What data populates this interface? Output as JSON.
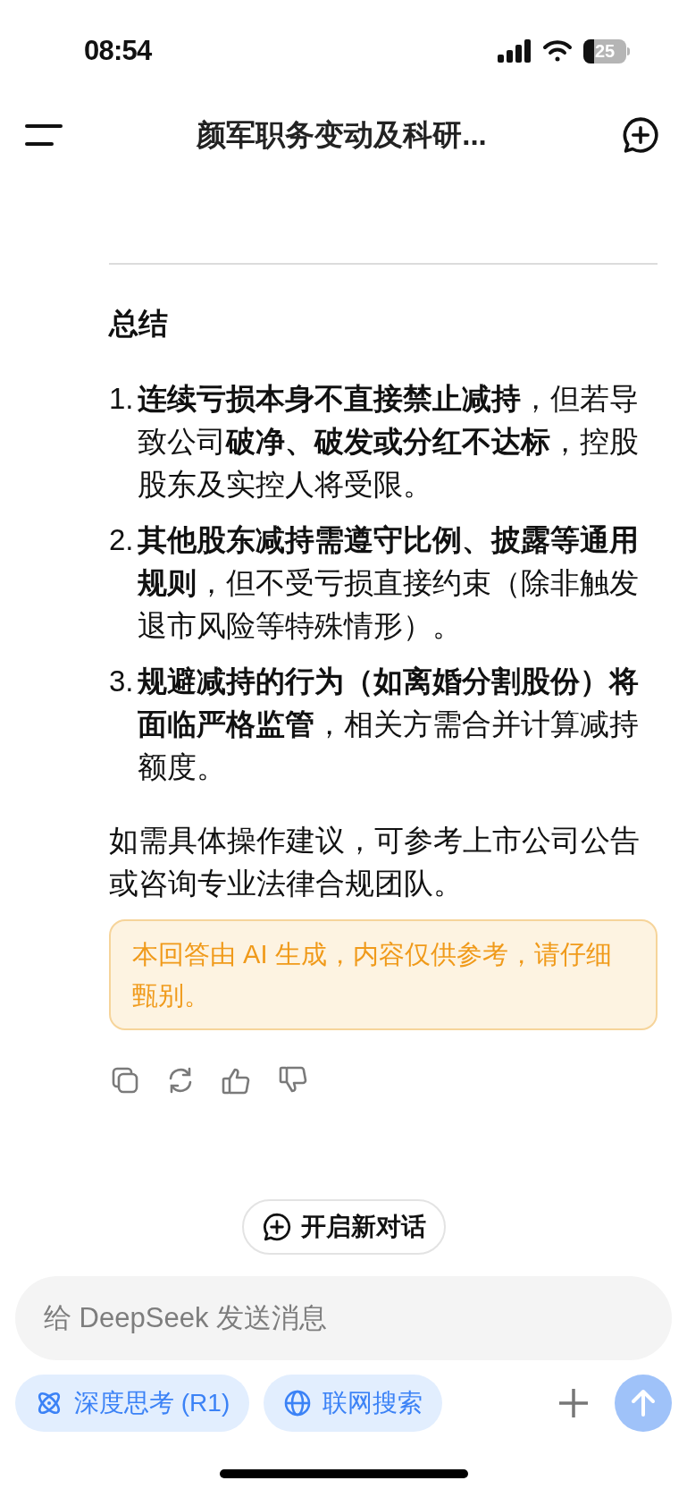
{
  "status_bar": {
    "time": "08:54",
    "battery": "25"
  },
  "header": {
    "title": "颜军职务变动及科研..."
  },
  "section_title": "总结",
  "list": [
    {
      "number": "1.",
      "text": "**连续亏损本身不直接禁止减持**，但若导致公司**破净、破发或分红不达标**，控股股东及实控人将受限。"
    },
    {
      "number": "2.",
      "text": "**其他股东减持需遵守比例、披露等通用规则**，但不受亏损直接约束（除非触发退市风险等特殊情形）。"
    },
    {
      "number": "3.",
      "text": "**规避减持的行为（如离婚分割股份）将面临严格监管**，相关方需合并计算减持额度。"
    }
  ],
  "closing": "如需具体操作建议，可参考上市公司公告或咨询专业法律合规团队。",
  "notice": "本回答由 AI 生成，内容仅供参考，请仔细甄别。",
  "new_chat": {
    "label": "开启新对话"
  },
  "composer": {
    "placeholder": "给 DeepSeek 发送消息"
  },
  "toggles": [
    {
      "kind": "think",
      "label": "深度思考 (R1)",
      "selected": true
    },
    {
      "kind": "search",
      "label": "联网搜索",
      "selected": true
    }
  ],
  "send": {
    "disabled": true
  }
}
